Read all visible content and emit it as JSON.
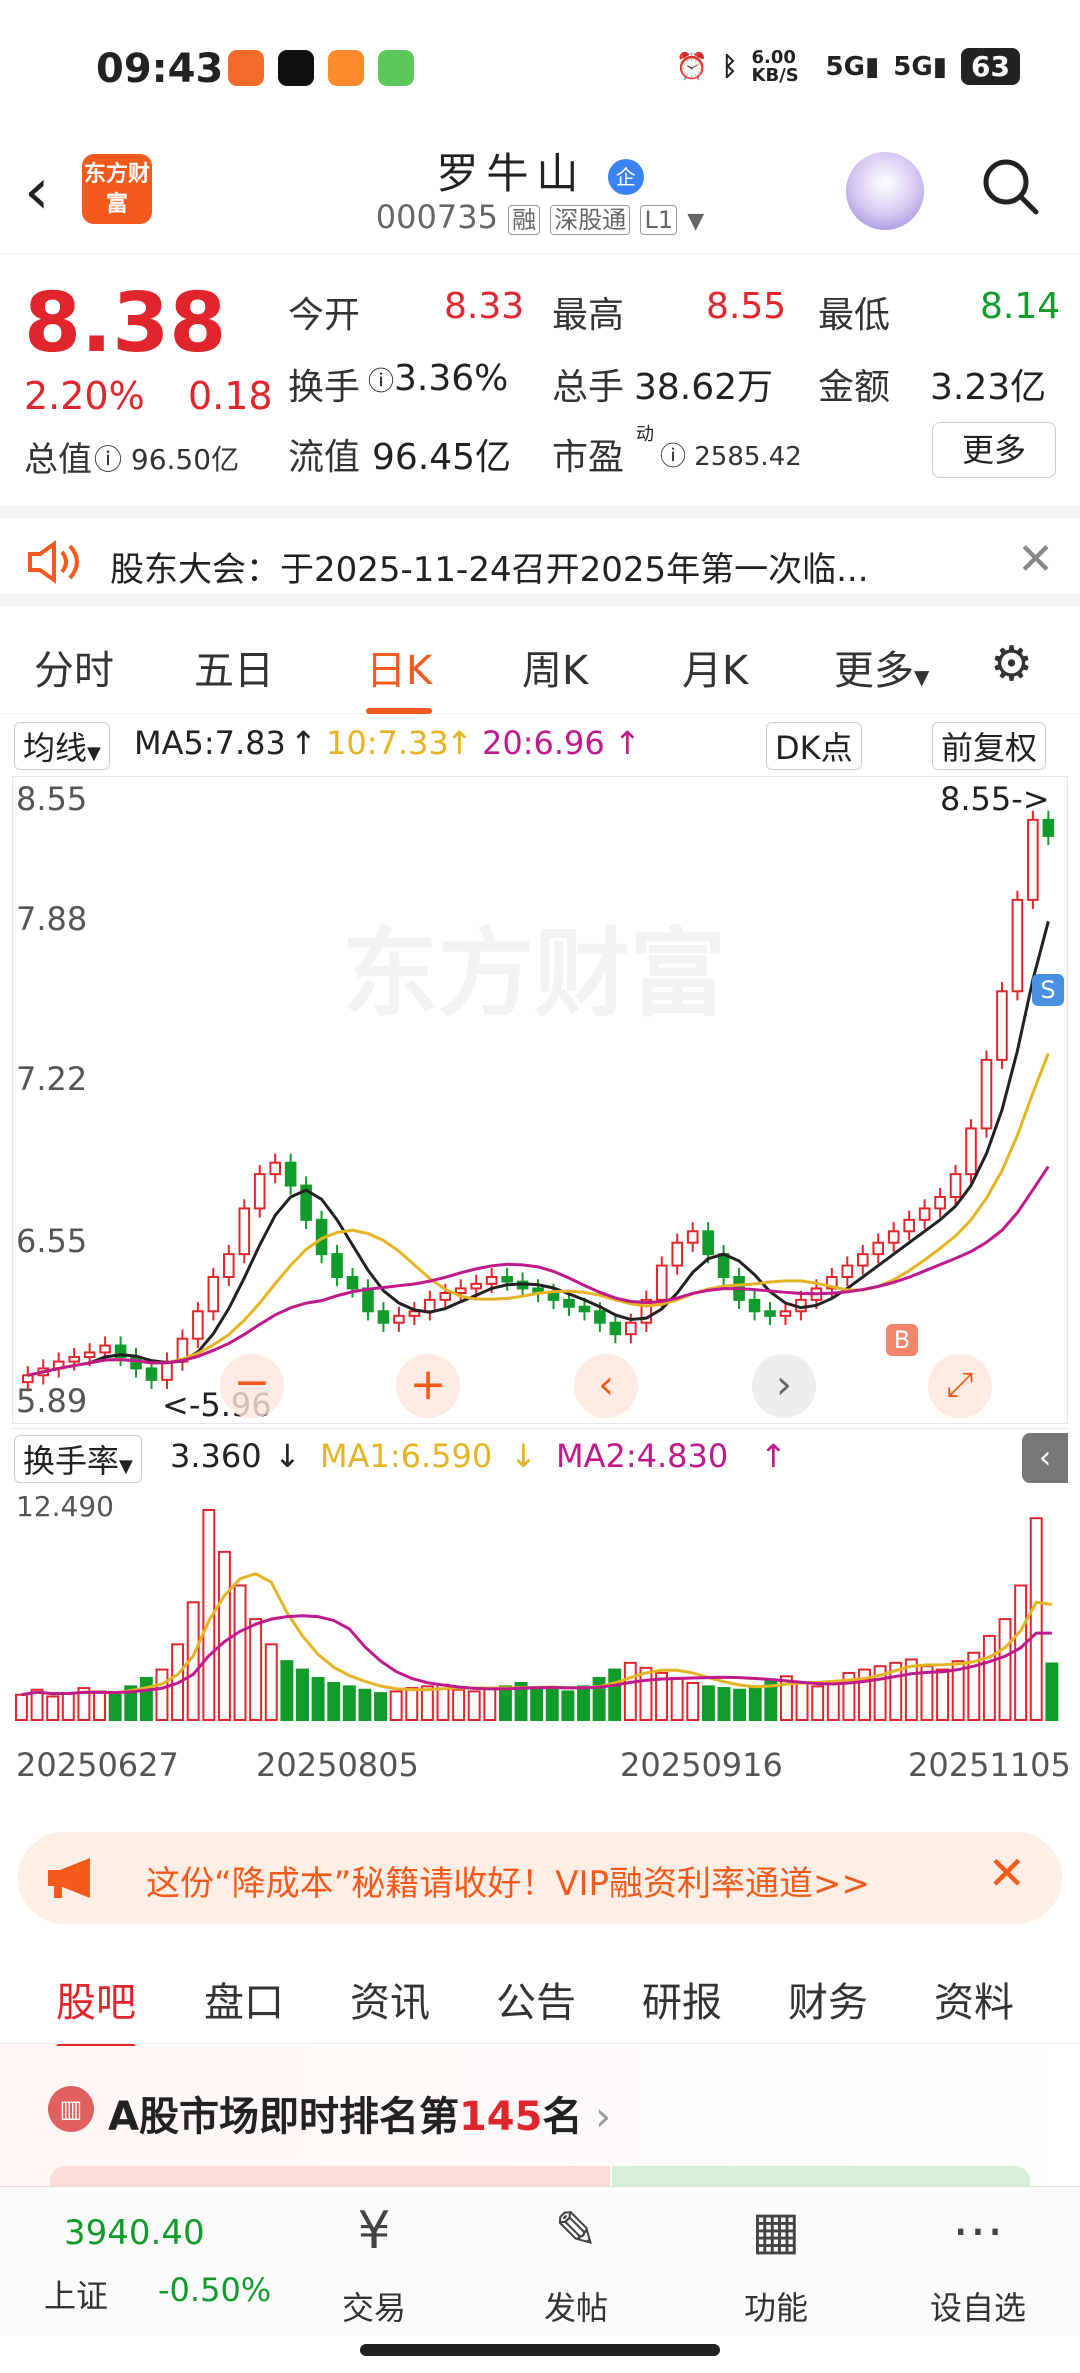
{
  "status": {
    "time": "09:43",
    "net": "6.00 KB/S",
    "signal1": "5G",
    "signal2": "5G",
    "battery": "63"
  },
  "header": {
    "name": "罗牛山",
    "badge": "企",
    "code": "000735",
    "tags": [
      "融",
      "深股通",
      "L1"
    ],
    "logo": "东方财富"
  },
  "quote": {
    "price": "8.38",
    "pct": "2.20%",
    "chg": "0.18",
    "open_label": "今开",
    "open": "8.33",
    "high_label": "最高",
    "high": "8.55",
    "low_label": "最低",
    "low": "8.14",
    "turnover_label": "换手",
    "turnover": "3.36%",
    "vol_label": "总手",
    "vol": "38.62万",
    "amount_label": "金额",
    "amount": "3.23亿",
    "mcap_label": "总值",
    "mcap": "96.50亿",
    "float_label": "流值",
    "float": "96.45亿",
    "pe_label": "市盈",
    "pe_sup": "动",
    "pe": "2585.42",
    "more": "更多"
  },
  "notice": {
    "text": "股东大会：于2025-11-24召开2025年第一次临..."
  },
  "tabs": {
    "items": [
      "分时",
      "五日",
      "日K",
      "周K",
      "月K",
      "更多"
    ],
    "active": 2
  },
  "ma": {
    "type": "均线",
    "ma5": "MA5:7.83",
    "ma10": "10:7.33",
    "ma20": "20:6.96",
    "dk": "DK点",
    "adj": "前复权"
  },
  "chart_data": [
    {
      "type": "candlestick",
      "title": "日K",
      "y_ticks": [
        "8.55",
        "7.88",
        "7.22",
        "6.55",
        "5.89"
      ],
      "ylim": [
        5.89,
        8.55
      ],
      "high_annotation": "8.55->",
      "low_annotation": "<-5.96",
      "x_ticks": [
        "20250627",
        "20250805",
        "20250916",
        "20251105"
      ],
      "closes": [
        6.02,
        6.05,
        6.08,
        6.1,
        6.12,
        6.15,
        6.1,
        6.05,
        6.0,
        6.08,
        6.18,
        6.3,
        6.45,
        6.55,
        6.75,
        6.9,
        6.95,
        6.85,
        6.7,
        6.55,
        6.45,
        6.4,
        6.3,
        6.25,
        6.28,
        6.3,
        6.35,
        6.38,
        6.4,
        6.42,
        6.45,
        6.43,
        6.4,
        6.38,
        6.35,
        6.32,
        6.3,
        6.25,
        6.2,
        6.25,
        6.35,
        6.5,
        6.6,
        6.65,
        6.55,
        6.45,
        6.35,
        6.3,
        6.28,
        6.3,
        6.35,
        6.4,
        6.45,
        6.5,
        6.55,
        6.6,
        6.65,
        6.7,
        6.75,
        6.8,
        6.9,
        7.1,
        7.4,
        7.7,
        8.1,
        8.45,
        8.38
      ],
      "ma5": "7.83",
      "ma10": "7.33",
      "ma20": "6.96",
      "markers": [
        "B",
        "S"
      ]
    },
    {
      "type": "bar",
      "title": "换手率",
      "ymax_label": "12.490",
      "values": [
        1.5,
        1.8,
        1.4,
        1.6,
        1.9,
        1.7,
        1.5,
        2.0,
        2.5,
        3.0,
        4.5,
        7.0,
        12.49,
        10.0,
        8.0,
        6.0,
        4.5,
        3.5,
        3.0,
        2.5,
        2.2,
        2.0,
        1.8,
        1.6,
        1.7,
        1.9,
        2.0,
        2.1,
        1.8,
        1.7,
        1.9,
        2.0,
        2.2,
        1.9,
        1.8,
        1.7,
        2.0,
        2.5,
        3.0,
        3.4,
        3.1,
        2.8,
        2.5,
        2.2,
        2.0,
        1.9,
        1.8,
        2.0,
        2.4,
        2.6,
        2.2,
        2.0,
        2.3,
        2.8,
        3.0,
        3.2,
        3.4,
        3.6,
        3.2,
        3.0,
        3.5,
        4.0,
        5.0,
        6.0,
        8.0,
        12.0,
        3.36
      ],
      "turnover": "3.360",
      "ma1": "MA1:6.590",
      "ma2": "MA2:4.830"
    }
  ],
  "promo": {
    "text": "这份“降成本”秘籍请收好！VIP融资利率通道>>"
  },
  "subtabs": {
    "items": [
      "股吧",
      "盘口",
      "资讯",
      "公告",
      "研报",
      "财务",
      "资料"
    ],
    "active": 0
  },
  "rank": {
    "prefix": "A股市场即时排名第",
    "num": "145",
    "suffix": "名"
  },
  "bottom": {
    "index_val": "3940.40",
    "index_name": "上证",
    "index_pct": "-0.50%",
    "items": [
      {
        "label": "交易",
        "icon": "yen-exchange-icon"
      },
      {
        "label": "发帖",
        "icon": "edit-icon"
      },
      {
        "label": "功能",
        "icon": "grid-icon"
      },
      {
        "label": "设自选",
        "icon": "more-dots-icon"
      }
    ]
  }
}
